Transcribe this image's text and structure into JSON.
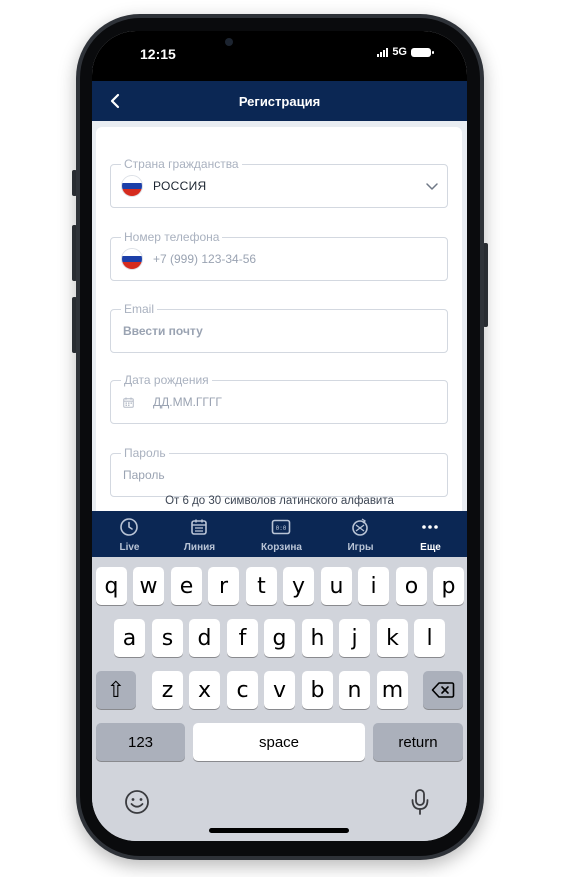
{
  "status": {
    "time": "12:15",
    "network": "5G"
  },
  "header": {
    "title": "Регистрация"
  },
  "form": {
    "country": {
      "label": "Страна гражданства",
      "value": "РОССИЯ"
    },
    "phone": {
      "label": "Номер телефона",
      "placeholder": "+7 (999) 123-34-56"
    },
    "email": {
      "label": "Email",
      "placeholder": "Ввести почту"
    },
    "birthdate": {
      "label": "Дата рождения",
      "placeholder": "ДД.ММ.ГГГГ"
    },
    "password": {
      "label": "Пароль",
      "placeholder": "Пароль",
      "hint": "От 6 до 30 символов латинского алфавита"
    }
  },
  "tabs": [
    {
      "label": "Live",
      "icon": "clock-icon"
    },
    {
      "label": "Линия",
      "icon": "calendar-icon"
    },
    {
      "label": "Корзина",
      "icon": "scoreboard-icon"
    },
    {
      "label": "Игры",
      "icon": "games-icon"
    },
    {
      "label": "Еще",
      "icon": "more-icon",
      "active": true
    }
  ],
  "keyboard": {
    "row1": [
      "q",
      "w",
      "e",
      "r",
      "t",
      "y",
      "u",
      "i",
      "o",
      "p"
    ],
    "row2": [
      "a",
      "s",
      "d",
      "f",
      "g",
      "h",
      "j",
      "k",
      "l"
    ],
    "row3": [
      "z",
      "x",
      "c",
      "v",
      "b",
      "n",
      "m"
    ],
    "numbers_label": "123",
    "space_label": "space",
    "return_label": "return",
    "shift_glyph": "⇧"
  },
  "colors": {
    "brand": "#0b2754",
    "flag_white": "#ffffff",
    "flag_blue": "#1c3fa8",
    "flag_red": "#d52b1e"
  }
}
